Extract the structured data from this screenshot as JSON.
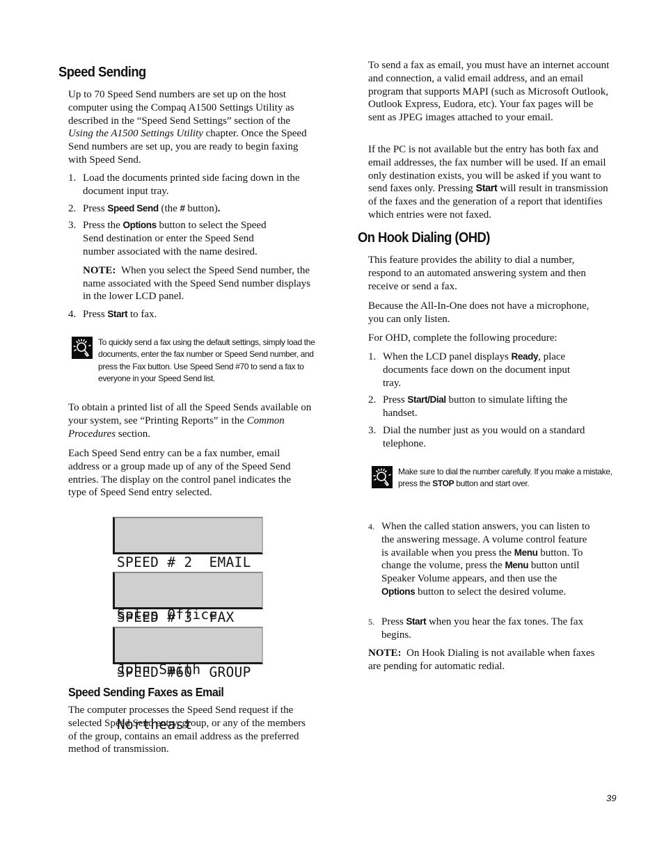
{
  "page_number": "39",
  "left": {
    "heading": "Speed Sending",
    "intro": {
      "part1": "Up to 70 Speed Send numbers are set up on the host computer using the Compaq A1500 Settings Utility as described in the “Speed Send Settings” section of the ",
      "italic": "Using the A1500 Settings Utility",
      "part2": " chapter. Once the Speed Send numbers are set up, you are ready to begin faxing with Speed Send."
    },
    "steps": [
      {
        "num": "1.",
        "text": "Load the documents printed side facing down in the document input tray."
      },
      {
        "num": "2.",
        "pre": "Press ",
        "kw": "Speed Send",
        "mid": " (the ",
        "kw2": "#",
        "post": " button)",
        "end": "."
      },
      {
        "num": "3.",
        "pre": "Press the ",
        "kw": "Options",
        "post": " button to select the Speed Send destination or enter the Speed Send number associated with the name desired."
      },
      {
        "num": "4.",
        "pre": "Press ",
        "kw": "Start",
        "post": " to fax."
      }
    ],
    "step3_note": {
      "label": "NOTE:",
      "text": "When you select the Speed Send number, the name associated with the Speed Send number displays in the lower LCD panel."
    },
    "tip": {
      "icon": "lightbulb-icon",
      "text": "To quickly send a fax using the default settings, simply load the documents, enter the fax number or Speed Send number, and press the Fax button. Use Speed Send #70 to send a fax to everyone in your Speed Send list."
    },
    "para_reports": {
      "part1": "To obtain a printed list of all the Speed Sends available on your system, see “Printing Reports” in the ",
      "italic": "Common Procedures",
      "part2": " section."
    },
    "para_entry": "Each Speed Send entry can be a fax number, email address or a group made up of any of the Speed Send entries. The display on the control panel indicates the type of Speed Send entry selected.",
    "lcd_displays": [
      {
        "line1": "SPEED # 2  EMAIL",
        "line2": "Sales Office"
      },
      {
        "line1": "SPEED # 3  FAX",
        "line2": "John Smith"
      },
      {
        "line1": "SPEED #60  GROUP",
        "line2": "Northeast"
      }
    ],
    "subheading": "Speed Sending Faxes as Email",
    "para_email": "The computer processes the Speed Send request if the selected Speed Send entry, group, or any of the members of the group, contains an email address as the preferred method of transmission."
  },
  "right": {
    "para_email_req": "To send a fax as email, you must have an internet account and connection, a valid email address, and an email program that supports MAPI (such as Microsoft Outlook, Outlook Express, Eudora, etc). Your fax pages will be sent as JPEG images attached to your email.",
    "para_pc": {
      "pre": "If the PC is not available but the entry has both fax and email addresses, the fax number will be used. If an email only destination exists, you will be asked if you want to send faxes only. Pressing ",
      "kw": "Start",
      "post": " will result in transmission of the faxes and the generation of a report that identifies which entries were not faxed."
    },
    "heading": "On Hook Dialing (OHD)",
    "para_feature": "This feature provides the ability to dial a number, respond to an automated answering system and then receive or send a fax.",
    "para_mic": "Because the All-In-One does not have a microphone, you can only listen.",
    "para_proc": "For OHD, complete the following procedure:",
    "steps": [
      {
        "num": "1.",
        "pre": "When the LCD panel displays ",
        "kw": "Ready",
        "post": ", place documents face down on the document input tray."
      },
      {
        "num": "2.",
        "pre": "Press ",
        "kw": "Start/Dial",
        "post": " button to simulate lifting the handset."
      },
      {
        "num": "3.",
        "text": "Dial the number just as you would on a standard telephone."
      }
    ],
    "tip": {
      "icon": "lightbulb-icon",
      "pre": "Make sure to dial the number carefully. If you make a mistake, press the ",
      "kw": "STOP",
      "post": " button and start over."
    },
    "step4": {
      "num": "4.",
      "t1": "When the called station answers, you can listen to the answering message. A volume control feature is available when you press the ",
      "kw1": "Menu",
      "t2": " button. To change the volume, press the ",
      "kw2": "Menu",
      "t3": " button until Speaker Volume appears, and then use the ",
      "kw3": "Options",
      "t4": " button to select the desired volume."
    },
    "step5": {
      "num": "5.",
      "pre": "Press ",
      "kw": "Start",
      "post": " when you hear the fax tones. The fax begins."
    },
    "note": {
      "label": "NOTE:",
      "text": "On Hook Dialing is not available when faxes are pending for automatic redial."
    }
  }
}
